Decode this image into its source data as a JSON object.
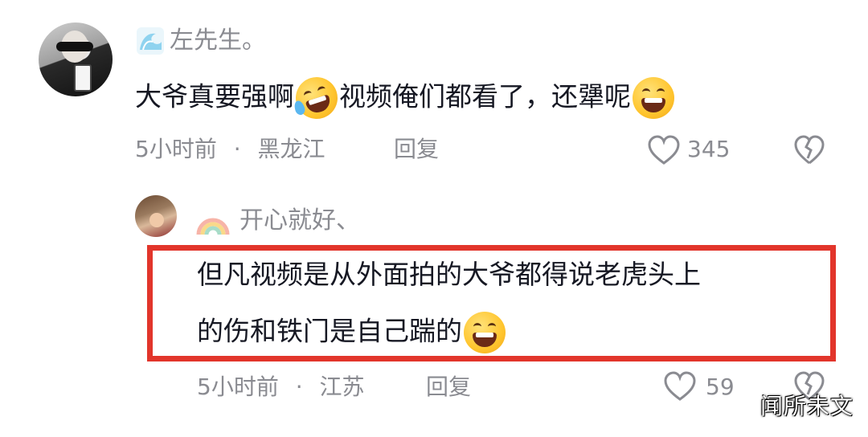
{
  "comment1": {
    "username": "左先生。",
    "text_part1": "大爷真要强啊",
    "text_part2": "视频俺们都看了，还犟呢",
    "time": "5小时前",
    "dot": "·",
    "location": "黑龙江",
    "reply_label": "回复",
    "like_count": "345",
    "emoji1": "laughing-crying-emoji",
    "emoji2": "grinning-squint-emoji",
    "badge_icon": "wave-badge-icon"
  },
  "comment2": {
    "username": "开心就好、",
    "text_line1": "但凡视频是从外面拍的大爷都得说老虎头上",
    "text_line2": "的伤和铁门是自己踹的",
    "time": "5小时前",
    "dot": "·",
    "location": "江苏",
    "reply_label": "回复",
    "like_count": "59",
    "emoji1": "grinning-squint-emoji",
    "badge_icon": "rainbow-badge-icon"
  },
  "highlight_color": "#e2352b",
  "watermark": "闻所未文"
}
